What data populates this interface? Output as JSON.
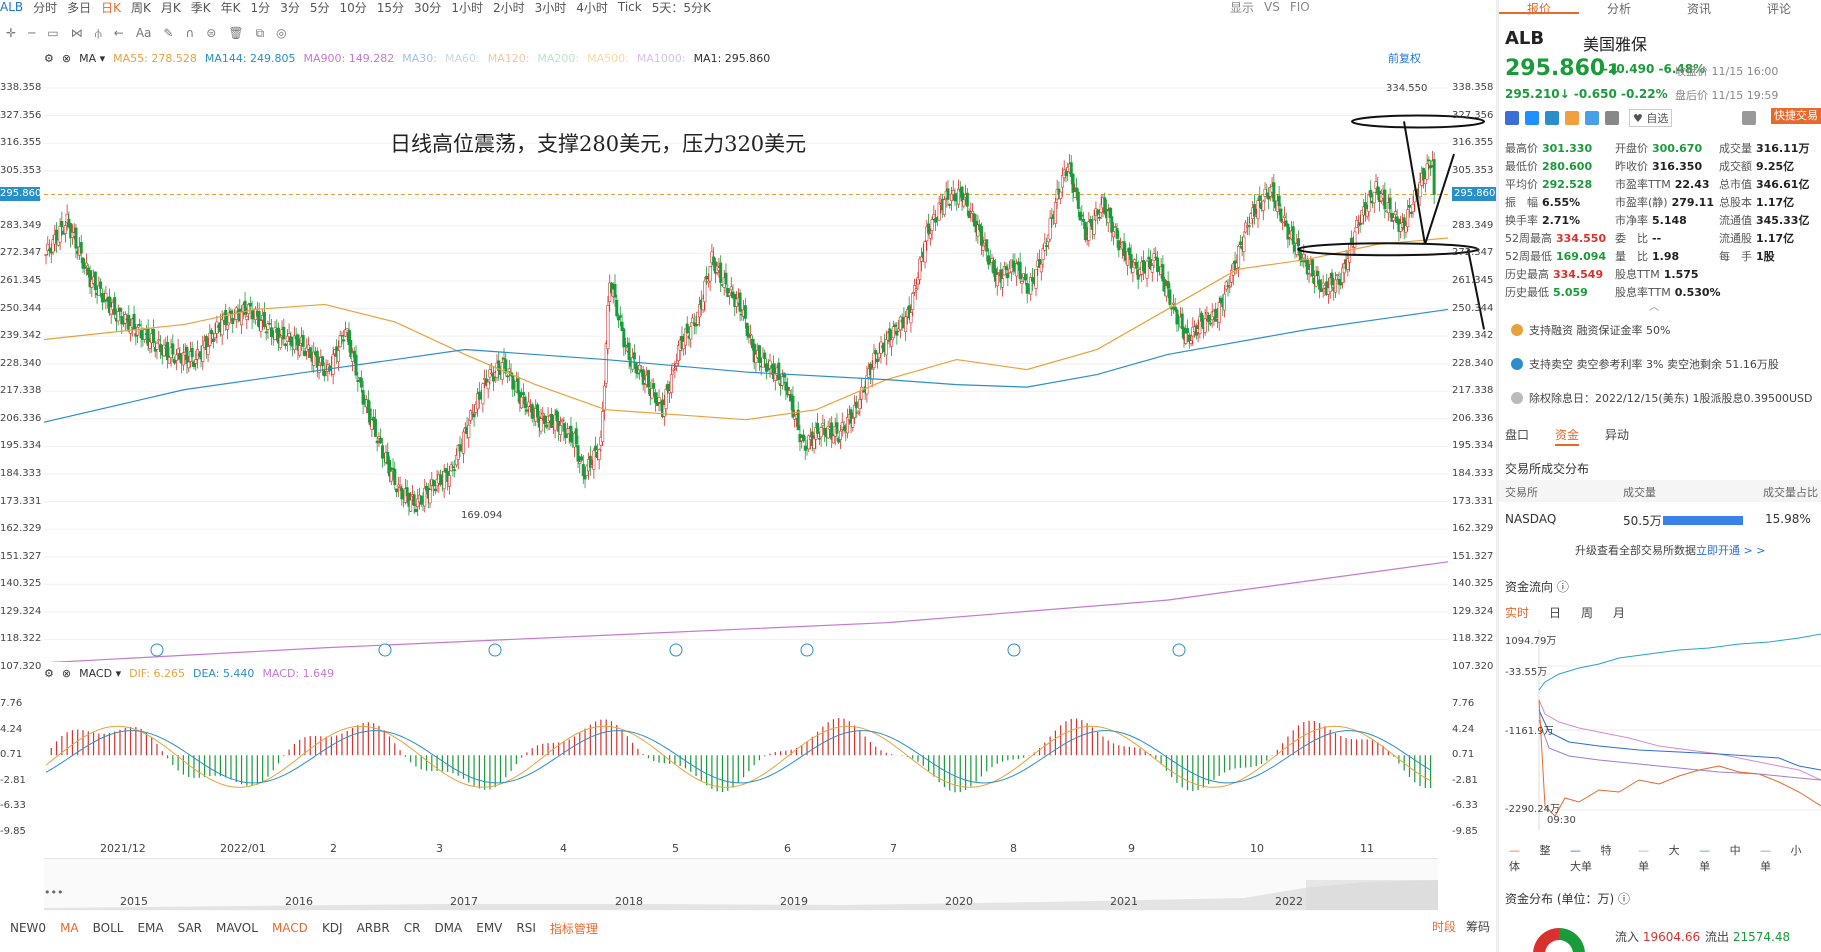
{
  "toolbar": {
    "symbol": "ALB",
    "periods": [
      "分时",
      "多日",
      "日K",
      "周K",
      "月K",
      "季K",
      "年K",
      "1分",
      "3分",
      "5分",
      "10分",
      "15分",
      "30分",
      "1小时",
      "2小时",
      "3小时",
      "4小时",
      "Tick",
      "5天：5分K"
    ],
    "active_period": "日K",
    "right_items": [
      "显示",
      "VS",
      "FIO"
    ]
  },
  "ma_legend": {
    "indicator": "MA",
    "items": [
      {
        "label": "MA55:",
        "value": "278.528",
        "color": "#e8a23c"
      },
      {
        "label": "MA144:",
        "value": "249.805",
        "color": "#2a8fc9"
      },
      {
        "label": "MA900:",
        "value": "149.282",
        "color": "#c47ad1"
      },
      {
        "label": "MA30:",
        "value": "",
        "color": "#9fc3e6"
      },
      {
        "label": "MA60:",
        "value": "",
        "color": "#c9d7e8"
      },
      {
        "label": "MA120:",
        "value": "",
        "color": "#f3c6a4"
      },
      {
        "label": "MA200:",
        "value": "",
        "color": "#bfe3c9"
      },
      {
        "label": "MA500:",
        "value": "",
        "color": "#f6d9a0"
      },
      {
        "label": "MA1000:",
        "value": "",
        "color": "#d5c2ea"
      },
      {
        "label": "MA1:",
        "value": "295.860",
        "color": "#333333"
      }
    ],
    "restore": "前复权"
  },
  "price_axis": [
    "338.358",
    "327.356",
    "316.355",
    "305.353",
    "294.351",
    "283.349",
    "272.347",
    "261.345",
    "250.344",
    "239.342",
    "228.340",
    "217.338",
    "206.336",
    "195.334",
    "184.333",
    "173.331",
    "162.329",
    "151.327",
    "140.325",
    "129.324",
    "118.322",
    "107.320"
  ],
  "current_price_tag": "295.860",
  "annotation": "日线高位震荡，支撑280美元，压力320美元",
  "high_label": "334.550",
  "low_label": "169.094",
  "macd_legend": {
    "indicator": "MACD",
    "items": [
      {
        "label": "DIF:",
        "value": "6.265",
        "color": "#e8a23c"
      },
      {
        "label": "DEA:",
        "value": "5.440",
        "color": "#2a8fc9"
      },
      {
        "label": "MACD:",
        "value": "1.649",
        "color": "#c47ad1"
      }
    ]
  },
  "macd_axis": [
    "7.76",
    "4.24",
    "0.71",
    "-2.81",
    "-6.33",
    "-9.85"
  ],
  "x_axis": [
    "2021/12",
    "2022/01",
    "2",
    "3",
    "4",
    "5",
    "6",
    "7",
    "8",
    "9",
    "10",
    "11"
  ],
  "navigator_years": [
    "2015",
    "2016",
    "2017",
    "2018",
    "2019",
    "2020",
    "2021",
    "2022"
  ],
  "indicator_bar": {
    "items": [
      "NEW0",
      "MA",
      "BOLL",
      "EMA",
      "SAR",
      "MAVOL",
      "MACD",
      "KDJ",
      "ARBR",
      "CR",
      "DMA",
      "EMV",
      "RSI"
    ],
    "active": [
      "MA",
      "MACD"
    ],
    "manage": "指标管理",
    "right": [
      "时段",
      "筹码"
    ]
  },
  "panel": {
    "tabs": [
      "报价",
      "分析",
      "资讯",
      "评论"
    ],
    "active_tab": "报价",
    "symbol": "ALB",
    "name": "美国雅保",
    "price": "295.860",
    "change": "-20.490",
    "change_pct": "-6.48%",
    "closed_time": "收盘价 11/15 16:00",
    "post_price": "295.210",
    "post_change": "-0.650",
    "post_pct": "-0.22%",
    "post_time": "盘后价 11/15 19:59",
    "fav": "自选",
    "quick": "快捷交易",
    "stats": [
      [
        {
          "k": "最高价",
          "v": "301.330",
          "c": "g"
        },
        {
          "k": "开盘价",
          "v": "300.670",
          "c": "g"
        },
        {
          "k": "成交量",
          "v": "316.11万",
          "c": "b"
        }
      ],
      [
        {
          "k": "最低价",
          "v": "280.600",
          "c": "g"
        },
        {
          "k": "昨收价",
          "v": "316.350",
          "c": "b"
        },
        {
          "k": "成交额",
          "v": "9.25亿",
          "c": "b"
        }
      ],
      [
        {
          "k": "平均价",
          "v": "292.528",
          "c": "g"
        },
        {
          "k": "市盈率TTM",
          "v": "22.43",
          "c": "b"
        },
        {
          "k": "总市值",
          "v": "346.61亿",
          "c": "b"
        }
      ],
      [
        {
          "k": "振　幅",
          "v": "6.55%",
          "c": "b"
        },
        {
          "k": "市盈率(静)",
          "v": "279.11",
          "c": "b"
        },
        {
          "k": "总股本",
          "v": "1.17亿",
          "c": "b"
        }
      ],
      [
        {
          "k": "换手率",
          "v": "2.71%",
          "c": "b"
        },
        {
          "k": "市净率",
          "v": "5.148",
          "c": "b"
        },
        {
          "k": "流通值",
          "v": "345.33亿",
          "c": "b"
        }
      ],
      [
        {
          "k": "52周最高",
          "v": "334.550",
          "c": "r"
        },
        {
          "k": "委　比",
          "v": "--",
          "c": "b"
        },
        {
          "k": "流通股",
          "v": "1.17亿",
          "c": "b"
        }
      ],
      [
        {
          "k": "52周最低",
          "v": "169.094",
          "c": "g"
        },
        {
          "k": "量　比",
          "v": "1.98",
          "c": "b"
        },
        {
          "k": "每　手",
          "v": "1股",
          "c": "b"
        }
      ],
      [
        {
          "k": "历史最高",
          "v": "334.549",
          "c": "r"
        },
        {
          "k": "股息TTM",
          "v": "1.575",
          "c": "b"
        }
      ],
      [
        {
          "k": "历史最低",
          "v": "5.059",
          "c": "g"
        },
        {
          "k": "股息率TTM",
          "v": "0.530%",
          "c": "b"
        }
      ]
    ],
    "notices": [
      "支持融资 融资保证金率 50%",
      "支持卖空 卖空参考利率 3% 卖空池剩余 51.16万股",
      "除权除息日：2022/12/15(美东) 1股派股息0.39500USD"
    ],
    "tabs2": [
      "盘口",
      "资金",
      "异动"
    ],
    "tabs2_active": "资金",
    "exchange_title": "交易所成交分布",
    "exchange_headers": [
      "交易所",
      "成交量",
      "成交量占比"
    ],
    "exchange_row": {
      "name": "NASDAQ",
      "vol": "50.5万",
      "pct": "15.98%"
    },
    "upgrade_text": "升级查看全部交易所数据",
    "upgrade_link": "立即开通 > >",
    "flow_title": "资金流向",
    "flow_tabs": [
      "实时",
      "日",
      "周",
      "月"
    ],
    "flow_active": "实时",
    "flow_axis": [
      "1094.79万",
      "-33.55万",
      "-1161.9万",
      "-2290.24万"
    ],
    "flow_time": "09:30",
    "flow_legend": [
      {
        "label": "整体",
        "color": "#e8692c"
      },
      {
        "label": "特大单",
        "color": "#2a6fd4"
      },
      {
        "label": "大单",
        "color": "#d58ad6"
      },
      {
        "label": "中单",
        "color": "#23a5c9"
      },
      {
        "label": "小单",
        "color": "#9a7fd0"
      }
    ],
    "dist_title": "资金分布 (单位：万)",
    "dist_in_label": "流入",
    "dist_in": "19604.66",
    "dist_out_label": "流出",
    "dist_out": "21574.48"
  }
}
